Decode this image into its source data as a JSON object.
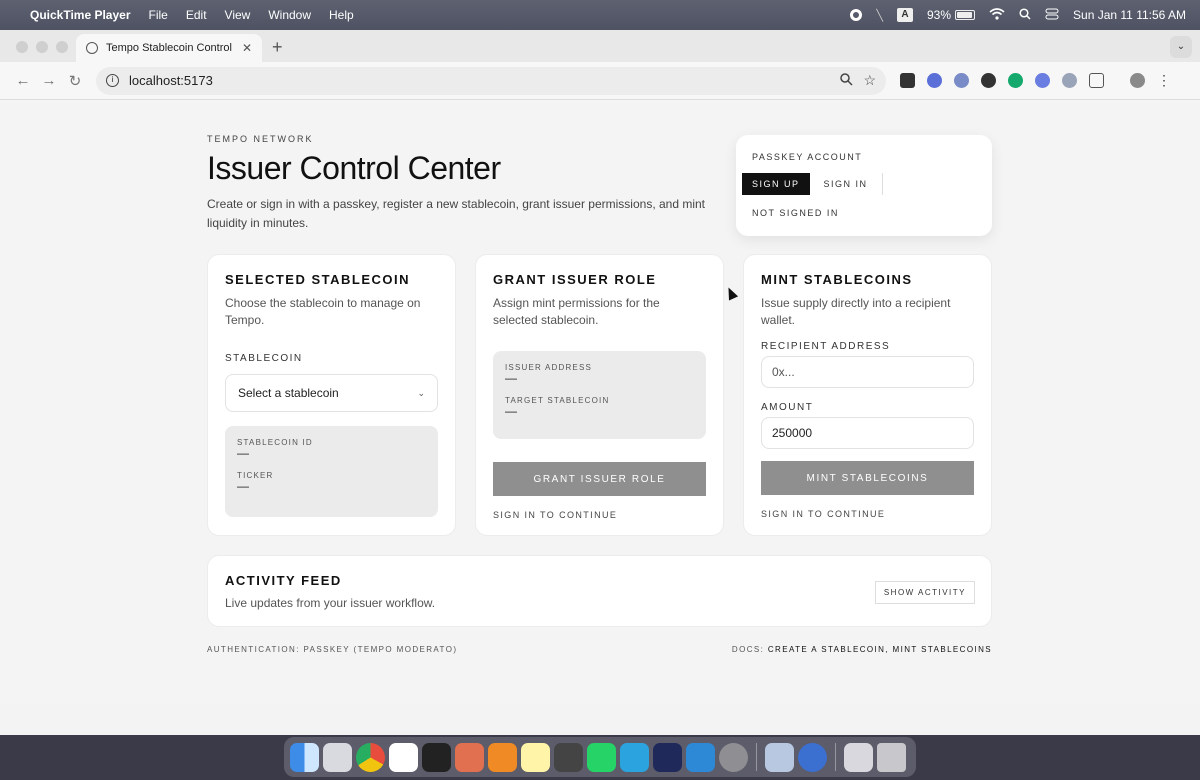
{
  "menubar": {
    "app_name": "QuickTime Player",
    "menus": [
      "File",
      "Edit",
      "View",
      "Window",
      "Help"
    ],
    "input_source": "A",
    "battery": "93%",
    "battery_level": 0.93,
    "datetime": "Sun Jan 11  11:56 AM"
  },
  "browser": {
    "tab_title": "Tempo Stablecoin Control Ce",
    "tab_close": "✕",
    "new_tab": "+",
    "url": "localhost:5173"
  },
  "page": {
    "eyebrow": "TEMPO NETWORK",
    "title": "Issuer Control Center",
    "intro": "Create or sign in with a passkey, register a new stablecoin, grant issuer permissions, and mint liquidity in minutes."
  },
  "passkey": {
    "label": "PASSKEY ACCOUNT",
    "sign_up": "SIGN UP",
    "sign_in": "SIGN IN",
    "status": "NOT SIGNED IN"
  },
  "selected_card": {
    "title": "SELECTED STABLECOIN",
    "subtitle": "Choose the stablecoin to manage on Tempo.",
    "field_label": "STABLECOIN",
    "select_value": "Select a stablecoin",
    "id_label": "STABLECOIN ID",
    "id_value": "—",
    "ticker_label": "TICKER",
    "ticker_value": "—"
  },
  "grant_card": {
    "title": "GRANT ISSUER ROLE",
    "subtitle": "Assign mint permissions for the selected stablecoin.",
    "issuer_label": "ISSUER ADDRESS",
    "issuer_value": "—",
    "target_label": "TARGET STABLECOIN",
    "target_value": "—",
    "button": "GRANT ISSUER ROLE",
    "hint": "SIGN IN TO CONTINUE"
  },
  "mint_card": {
    "title": "MINT STABLECOINS",
    "subtitle": "Issue supply directly into a recipient wallet.",
    "recipient_label": "RECIPIENT ADDRESS",
    "recipient_placeholder": "0x...",
    "amount_label": "AMOUNT",
    "amount_value": "250000",
    "button": "MINT STABLECOINS",
    "hint": "SIGN IN TO CONTINUE"
  },
  "activity": {
    "title": "ACTIVITY FEED",
    "subtitle": "Live updates from your issuer workflow.",
    "button": "SHOW ACTIVITY"
  },
  "footer": {
    "left": "AUTHENTICATION: PASSKEY (TEMPO MODERATO)",
    "docs_label": "DOCS:",
    "link1": "CREATE A STABLECOIN,",
    "link2": "MINT STABLECOINS"
  },
  "colors": {
    "primary_button": "#111111",
    "disabled_button": "#8f8f8f"
  }
}
